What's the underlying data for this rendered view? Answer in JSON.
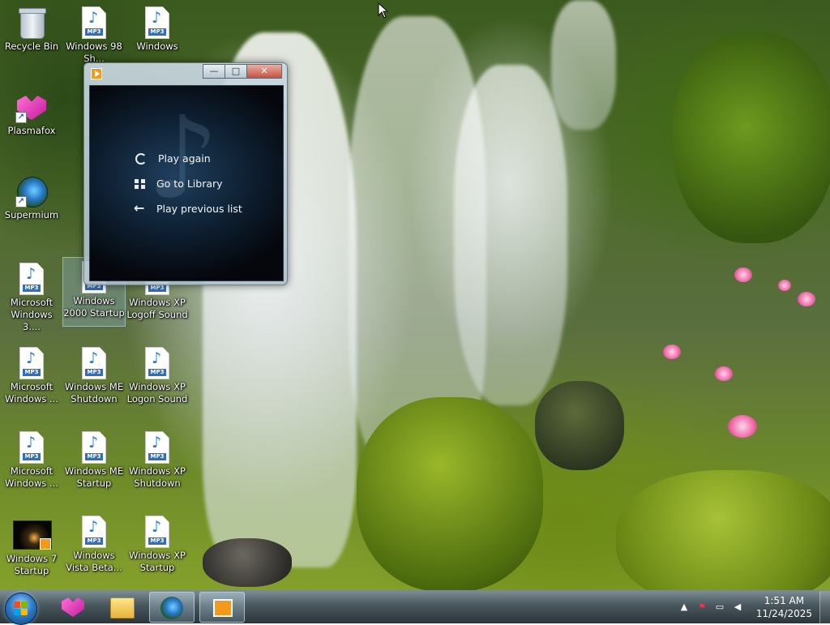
{
  "desktop": {
    "icons": [
      {
        "id": "recycle-bin",
        "label": "Recycle Bin",
        "type": "recycle-bin-icon"
      },
      {
        "id": "win98-shutdown",
        "label": "Windows 98 Sh...",
        "type": "mp3-file-icon"
      },
      {
        "id": "windows-file",
        "label": "Windows",
        "type": "mp3-file-icon"
      },
      {
        "id": "plasmafox",
        "label": "Plasmafox",
        "type": "plasmafox-icon"
      },
      {
        "id": "supermium",
        "label": "Supermium",
        "type": "supermium-browser-icon"
      },
      {
        "id": "ms-windows-3",
        "label": "Microsoft Windows 3....",
        "type": "mp3-file-icon"
      },
      {
        "id": "win2000-startup",
        "label": "Windows 2000 Startup",
        "type": "mp3-file-icon"
      },
      {
        "id": "winxp-logoff",
        "label": "Windows XP Logoff Sound",
        "type": "mp3-file-icon"
      },
      {
        "id": "ms-windows-a",
        "label": "Microsoft Windows ...",
        "type": "mp3-file-icon"
      },
      {
        "id": "winme-shutdown",
        "label": "Windows ME Shutdown",
        "type": "mp3-file-icon"
      },
      {
        "id": "winxp-logon",
        "label": "Windows XP Logon Sound",
        "type": "mp3-file-icon"
      },
      {
        "id": "ms-windows-b",
        "label": "Microsoft Windows ...",
        "type": "mp3-file-icon"
      },
      {
        "id": "winme-startup",
        "label": "Windows ME Startup",
        "type": "mp3-file-icon"
      },
      {
        "id": "winxp-shutdown",
        "label": "Windows XP Shutdown",
        "type": "mp3-file-icon"
      },
      {
        "id": "win7-startup",
        "label": "Windows 7 Startup",
        "type": "video-file-icon"
      },
      {
        "id": "vista-beta",
        "label": "Windows Vista Beta...",
        "type": "mp3-file-icon"
      },
      {
        "id": "winxp-startup",
        "label": "Windows XP Startup",
        "type": "mp3-file-icon"
      }
    ],
    "mp3_tag": "MP3",
    "selected_icon": "win2000-startup"
  },
  "wmp_window": {
    "title": "",
    "controls": {
      "minimize": "—",
      "maximize": "□",
      "close": "✕"
    },
    "menu": [
      {
        "label": "Play again",
        "icon": "replay-icon"
      },
      {
        "label": "Go to Library",
        "icon": "library-icon"
      },
      {
        "label": "Play previous list",
        "icon": "back-arrow-icon"
      }
    ]
  },
  "taskbar": {
    "pinned": [
      {
        "name": "plasmafox",
        "icon": "plasmafox-icon",
        "active": false
      },
      {
        "name": "windows-explorer",
        "icon": "folder-icon",
        "active": false
      },
      {
        "name": "supermium",
        "icon": "supermium-browser-icon",
        "active": false
      },
      {
        "name": "windows-media-player",
        "icon": "media-player-icon",
        "active": true
      }
    ],
    "tray": {
      "icons": [
        "show-hidden-icons-icon",
        "action-center-flag-icon",
        "network-icon",
        "volume-icon"
      ],
      "time": "1:51 AM",
      "date": "11/24/2025"
    }
  },
  "colors": {
    "taskbar": "#2a3a42",
    "accent_blue": "#2f7cc7",
    "wmp_orange": "#f39a1c",
    "flower_pink": "#f06aa8"
  }
}
